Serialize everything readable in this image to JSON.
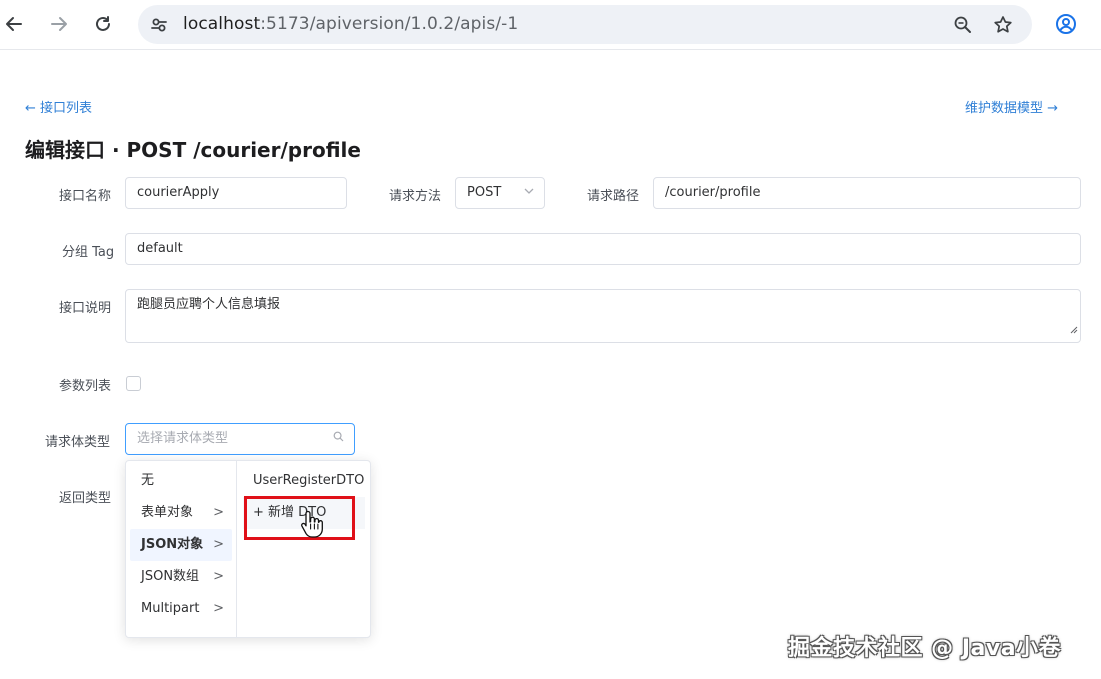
{
  "browser": {
    "url_host": "localhost",
    "url_path": ":5173/apiversion/1.0.2/apis/-1"
  },
  "nav": {
    "back_link": "← 接口列表",
    "model_link": "维护数据模型 →"
  },
  "page_title": "编辑接口 · POST /courier/profile",
  "form": {
    "name_label": "接口名称",
    "name_value": "courierApply",
    "method_label": "请求方法",
    "method_value": "POST",
    "path_label": "请求路径",
    "path_value": "/courier/profile",
    "tag_label": "分组 Tag",
    "tag_value": "default",
    "desc_label": "接口说明",
    "desc_value": "跑腿员应聘个人信息填报",
    "params_label": "参数列表",
    "body_type_label": "请求体类型",
    "body_type_placeholder": "选择请求体类型",
    "return_type_label": "返回类型"
  },
  "cascader": {
    "level1": [
      {
        "label": "无",
        "has_children": false
      },
      {
        "label": "表单对象",
        "has_children": true
      },
      {
        "label": "JSON对象",
        "has_children": true,
        "active": true
      },
      {
        "label": "JSON数组",
        "has_children": true
      },
      {
        "label": "Multipart",
        "has_children": true
      }
    ],
    "level2": [
      {
        "label": "UserRegisterDTO"
      },
      {
        "label": "+ 新增 DTO",
        "hover": true
      }
    ],
    "arrow_glyph": ">"
  },
  "watermark": "掘金技术社区 @ Java小卷",
  "colors": {
    "link": "#2f7fd6",
    "focus_border": "#409eff",
    "highlight_box": "#e01018"
  }
}
